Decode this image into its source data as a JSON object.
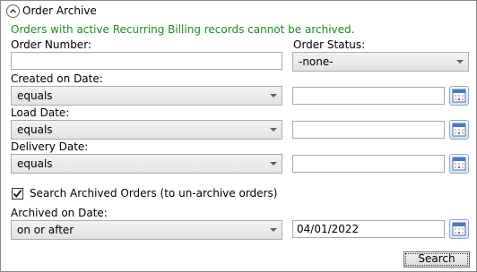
{
  "header": {
    "title": "Order Archive",
    "notice": "Orders with active Recurring Billing records cannot be archived."
  },
  "order_number": {
    "label": "Order Number:",
    "value": ""
  },
  "order_status": {
    "label": "Order Status:",
    "value": "-none-"
  },
  "created_on": {
    "label": "Created on Date:",
    "operator": "equals",
    "value": ""
  },
  "load_date": {
    "label": "Load Date:",
    "operator": "equals",
    "value": ""
  },
  "delivery_date": {
    "label": "Delivery Date:",
    "operator": "equals",
    "value": ""
  },
  "archived_checkbox": {
    "label": "Search Archived Orders (to un-archive orders)",
    "checked": true
  },
  "archived_on": {
    "label": "Archived on Date:",
    "operator": "on or after",
    "value": "04/01/2022"
  },
  "search_button": {
    "label": "Search"
  },
  "colors": {
    "notice": "#1e8a1e",
    "border": "#8a8a8a"
  },
  "icons": [
    "chevron-up-icon",
    "chevron-down-icon",
    "calendar-icon",
    "checkmark-icon"
  ]
}
